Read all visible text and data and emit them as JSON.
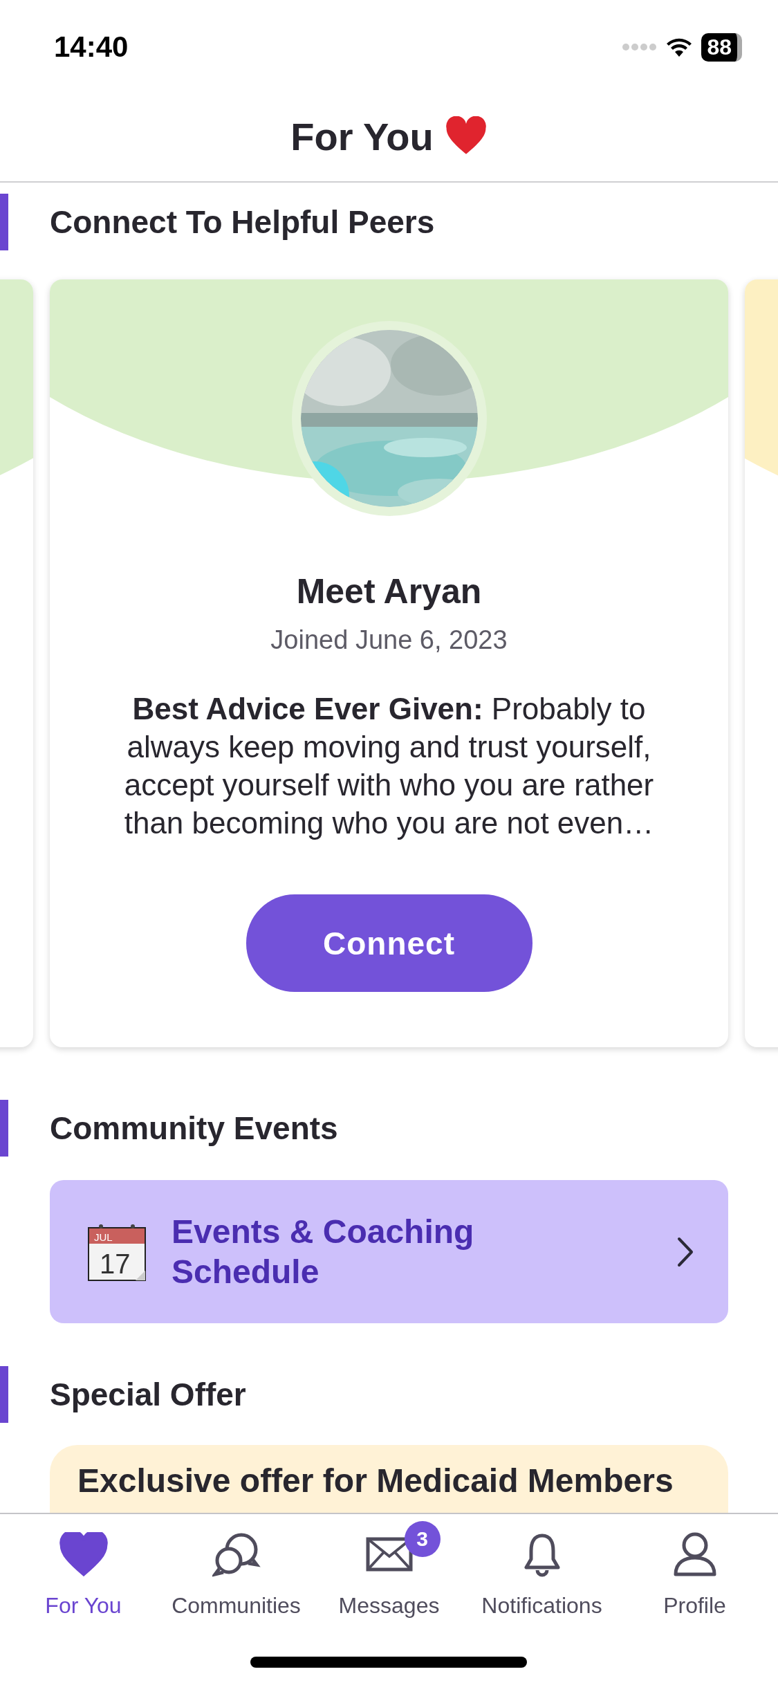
{
  "status_bar": {
    "time": "14:40",
    "battery": "88"
  },
  "header": {
    "title": "For You"
  },
  "peers": {
    "heading": "Connect To Helpful Peers",
    "card": {
      "name": "Meet Aryan",
      "joined": "Joined June 6, 2023",
      "advice": "**Best Advice Ever Given:** Probably to always keep moving and trust yourself, accept yourself with who you are rather than becoming who you are not even…",
      "button": "Connect"
    }
  },
  "events": {
    "heading": "Community Events",
    "calendar_month": "JUL",
    "calendar_day": "17",
    "link": "Events & Coaching Schedule"
  },
  "offer": {
    "heading": "Special Offer",
    "title": "Exclusive offer for Medicaid Members"
  },
  "tab_bar": [
    {
      "label": "For You",
      "selected": true
    },
    {
      "label": "Communities",
      "selected": false
    },
    {
      "label": "Messages",
      "selected": false,
      "badge": "3"
    },
    {
      "label": "Notifications",
      "selected": false
    },
    {
      "label": "Profile",
      "selected": false
    }
  ]
}
